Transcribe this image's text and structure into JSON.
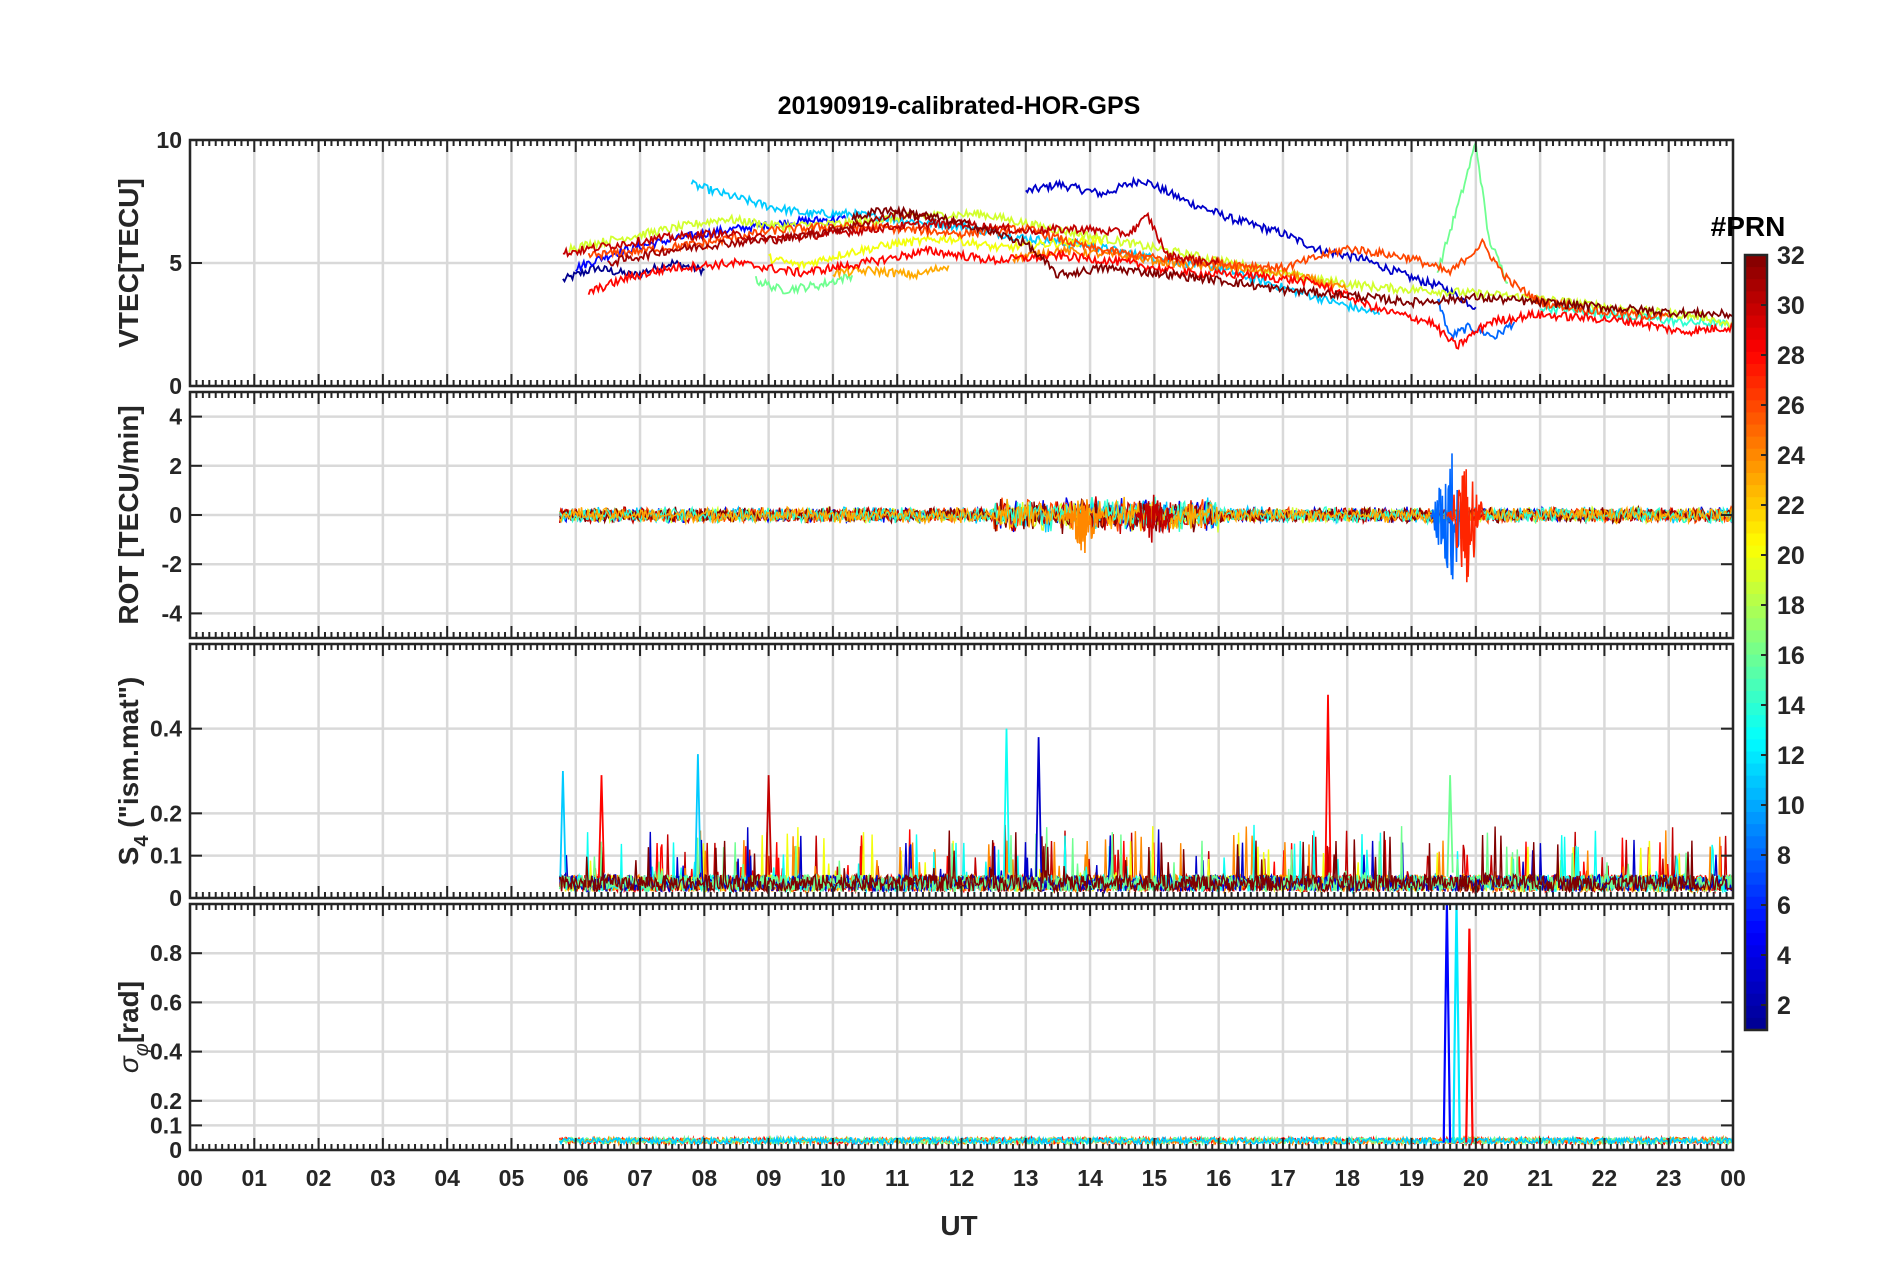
{
  "chart_data": {
    "type": "line",
    "title": "20190919-calibrated-HOR-GPS",
    "xlabel": "UT",
    "x_tick_labels": [
      "00",
      "01",
      "02",
      "03",
      "04",
      "05",
      "06",
      "07",
      "08",
      "09",
      "10",
      "11",
      "12",
      "13",
      "14",
      "15",
      "16",
      "17",
      "18",
      "19",
      "20",
      "21",
      "22",
      "23",
      "00"
    ],
    "xlim": [
      0,
      24
    ],
    "data_start_hour": 5.75,
    "grid": true,
    "panels": [
      {
        "id": "vtec",
        "ylabel": "VTEC[TECU]",
        "ylim": [
          0,
          10
        ],
        "yticks": [
          0,
          5,
          10
        ],
        "ytick_labels": [
          "0",
          "5",
          "10"
        ]
      },
      {
        "id": "rot",
        "ylabel": "ROT [TECU/min]",
        "ylim": [
          -5,
          5
        ],
        "yticks": [
          -4,
          -2,
          0,
          2,
          4
        ],
        "ytick_labels": [
          "-4",
          "-2",
          "0",
          "2",
          "4"
        ]
      },
      {
        "id": "s4",
        "ylabel_main": "S",
        "ylabel_sub": "4",
        "ylabel_rest": " (\"ism.mat\")",
        "ylim": [
          0,
          0.6
        ],
        "yticks": [
          0,
          0.1,
          0.2,
          0.4
        ],
        "ytick_labels": [
          "0",
          "0.1",
          "0.2",
          "0.4"
        ]
      },
      {
        "id": "sigma",
        "ylabel_main": "σ",
        "ylabel_sub": "φ",
        "ylabel_rest": "[rad]",
        "ylim": [
          0,
          1
        ],
        "yticks": [
          0,
          0.1,
          0.2,
          0.4,
          0.6,
          0.8
        ],
        "ytick_labels": [
          "0",
          "0.1",
          "0.2",
          "0.4",
          "0.6",
          "0.8"
        ]
      }
    ],
    "colorbar": {
      "title": "#PRN",
      "range": [
        1,
        32
      ],
      "ticks": [
        2,
        4,
        6,
        8,
        10,
        12,
        14,
        16,
        18,
        20,
        22,
        24,
        26,
        28,
        30,
        32
      ],
      "tick_labels": [
        "2",
        "4",
        "6",
        "8",
        "10",
        "12",
        "14",
        "16",
        "18",
        "20",
        "22",
        "24",
        "26",
        "28",
        "30",
        "32"
      ],
      "colormap": "jet",
      "colors": [
        "#00008f",
        "#0000ff",
        "#0080ff",
        "#00ffff",
        "#80ff80",
        "#ffff00",
        "#ff8000",
        "#ff0000",
        "#800000"
      ]
    },
    "approx_series": [
      {
        "prn": 1,
        "points": [
          [
            5.8,
            4.3
          ],
          [
            6.3,
            4.8
          ],
          [
            6.9,
            4.5
          ],
          [
            7.5,
            5.0
          ],
          [
            8.0,
            4.7
          ]
        ]
      },
      {
        "prn": 3,
        "points": [
          [
            13.0,
            7.9
          ],
          [
            13.5,
            8.2
          ],
          [
            14.2,
            7.8
          ],
          [
            14.8,
            8.4
          ],
          [
            15.5,
            7.5
          ],
          [
            16.2,
            6.8
          ],
          [
            17.0,
            6.2
          ],
          [
            17.6,
            5.5
          ],
          [
            18.2,
            5.2
          ],
          [
            19.0,
            4.4
          ],
          [
            19.5,
            4.0
          ],
          [
            20.0,
            3.2
          ]
        ]
      },
      {
        "prn": 5,
        "points": [
          [
            6.0,
            4.8
          ],
          [
            6.6,
            5.4
          ],
          [
            7.2,
            5.8
          ],
          [
            8.0,
            6.2
          ],
          [
            8.8,
            6.5
          ],
          [
            9.5,
            6.7
          ],
          [
            10.2,
            6.8
          ]
        ]
      },
      {
        "prn": 8,
        "points": [
          [
            19.4,
            3.6
          ],
          [
            19.6,
            2.0
          ],
          [
            19.9,
            2.4
          ],
          [
            20.3,
            2.0
          ],
          [
            20.6,
            2.6
          ]
        ]
      },
      {
        "prn": 11,
        "points": [
          [
            7.8,
            8.2
          ],
          [
            8.3,
            7.8
          ],
          [
            9.0,
            7.3
          ],
          [
            9.6,
            7.0
          ],
          [
            10.3,
            7.0
          ],
          [
            11.2,
            6.7
          ],
          [
            12.0,
            6.5
          ],
          [
            13.0,
            6.0
          ],
          [
            14.0,
            5.7
          ],
          [
            15.0,
            5.2
          ],
          [
            16.0,
            4.8
          ],
          [
            17.0,
            4.0
          ],
          [
            17.8,
            3.4
          ],
          [
            18.5,
            2.9
          ]
        ]
      },
      {
        "prn": 14,
        "points": [
          [
            21.0,
            3.2
          ],
          [
            21.8,
            3.0
          ],
          [
            22.5,
            2.8
          ],
          [
            23.2,
            2.6
          ],
          [
            24.0,
            2.5
          ]
        ]
      },
      {
        "prn": 16,
        "points": [
          [
            8.8,
            4.3
          ],
          [
            9.2,
            3.9
          ],
          [
            9.8,
            4.1
          ],
          [
            10.3,
            4.5
          ]
        ]
      },
      {
        "prn": 16,
        "points": [
          [
            19.4,
            4.6
          ],
          [
            19.8,
            8.0
          ],
          [
            20.0,
            9.9
          ],
          [
            20.2,
            6.0
          ],
          [
            20.5,
            4.2
          ]
        ]
      },
      {
        "prn": 19,
        "points": [
          [
            5.9,
            5.6
          ],
          [
            6.7,
            6.0
          ],
          [
            7.5,
            6.4
          ],
          [
            8.3,
            6.8
          ],
          [
            9.2,
            6.5
          ],
          [
            10.2,
            6.6
          ],
          [
            11.2,
            6.9
          ],
          [
            12.3,
            7.0
          ],
          [
            13.2,
            6.5
          ],
          [
            14.2,
            6.0
          ],
          [
            15.2,
            5.5
          ],
          [
            16.2,
            5.0
          ],
          [
            17.3,
            4.4
          ],
          [
            18.5,
            4.0
          ],
          [
            19.8,
            3.8
          ],
          [
            20.8,
            3.6
          ],
          [
            21.8,
            3.3
          ],
          [
            22.8,
            3.0
          ],
          [
            23.6,
            2.8
          ],
          [
            24.0,
            2.4
          ]
        ]
      },
      {
        "prn": 20,
        "points": [
          [
            9.0,
            5.2
          ],
          [
            9.5,
            4.9
          ],
          [
            10.2,
            5.4
          ],
          [
            11.0,
            5.8
          ],
          [
            11.8,
            6.0
          ],
          [
            12.6,
            5.6
          ],
          [
            13.4,
            5.8
          ],
          [
            14.2,
            5.9
          ]
        ]
      },
      {
        "prn": 23,
        "points": [
          [
            10.0,
            4.6
          ],
          [
            10.6,
            4.7
          ],
          [
            11.3,
            4.5
          ],
          [
            11.8,
            4.9
          ]
        ]
      },
      {
        "prn": 24,
        "points": [
          [
            12.8,
            5.2
          ],
          [
            13.5,
            5.5
          ],
          [
            14.5,
            5.3
          ],
          [
            15.5,
            4.9
          ],
          [
            16.3,
            4.8
          ],
          [
            17.2,
            4.5
          ],
          [
            18.0,
            3.9
          ]
        ]
      },
      {
        "prn": 26,
        "points": [
          [
            6.2,
            5.3
          ],
          [
            7.0,
            5.5
          ],
          [
            8.0,
            5.8
          ],
          [
            9.0,
            6.3
          ],
          [
            10.0,
            6.5
          ],
          [
            11.0,
            6.4
          ],
          [
            12.0,
            6.2
          ],
          [
            13.0,
            6.4
          ],
          [
            14.0,
            5.6
          ],
          [
            15.0,
            5.2
          ],
          [
            16.0,
            5.0
          ],
          [
            17.0,
            4.8
          ],
          [
            18.0,
            5.6
          ],
          [
            19.0,
            5.2
          ],
          [
            19.6,
            4.6
          ],
          [
            20.1,
            5.8
          ],
          [
            20.5,
            4.3
          ],
          [
            21.0,
            3.4
          ],
          [
            22.0,
            3.0
          ],
          [
            23.0,
            2.8
          ]
        ]
      },
      {
        "prn": 28,
        "points": [
          [
            6.2,
            3.8
          ],
          [
            6.8,
            4.4
          ],
          [
            7.5,
            4.8
          ],
          [
            8.5,
            5.0
          ],
          [
            9.5,
            4.6
          ],
          [
            10.5,
            5.0
          ],
          [
            11.5,
            5.5
          ],
          [
            12.5,
            5.1
          ],
          [
            13.5,
            5.3
          ],
          [
            14.6,
            5.0
          ],
          [
            15.4,
            4.6
          ],
          [
            16.5,
            4.5
          ],
          [
            17.5,
            4.2
          ],
          [
            18.5,
            3.1
          ],
          [
            19.3,
            2.6
          ],
          [
            19.7,
            1.6
          ],
          [
            20.2,
            2.6
          ],
          [
            20.9,
            2.9
          ],
          [
            21.6,
            2.8
          ],
          [
            22.5,
            2.6
          ],
          [
            23.2,
            2.2
          ],
          [
            24.0,
            2.4
          ]
        ]
      },
      {
        "prn": 30,
        "points": [
          [
            5.8,
            5.4
          ],
          [
            6.5,
            5.7
          ],
          [
            7.3,
            6.0
          ],
          [
            8.2,
            6.2
          ],
          [
            9.0,
            6.0
          ],
          [
            10.0,
            6.2
          ],
          [
            11.0,
            6.5
          ],
          [
            12.0,
            6.6
          ],
          [
            13.0,
            6.3
          ],
          [
            13.8,
            6.4
          ],
          [
            14.6,
            6.2
          ],
          [
            14.9,
            6.9
          ],
          [
            15.2,
            5.3
          ],
          [
            16.0,
            5.0
          ]
        ]
      },
      {
        "prn": 31,
        "points": [
          [
            6.5,
            5.0
          ],
          [
            7.4,
            5.5
          ],
          [
            8.3,
            5.8
          ],
          [
            9.3,
            6.0
          ],
          [
            10.3,
            6.5
          ],
          [
            11.0,
            7.0
          ],
          [
            11.6,
            6.8
          ]
        ]
      },
      {
        "prn": 32,
        "points": [
          [
            10.3,
            6.8
          ],
          [
            10.8,
            7.2
          ],
          [
            11.5,
            6.9
          ],
          [
            12.2,
            6.5
          ],
          [
            13.0,
            5.8
          ],
          [
            13.5,
            4.5
          ],
          [
            14.2,
            4.8
          ],
          [
            15.0,
            4.6
          ],
          [
            16.0,
            4.3
          ],
          [
            17.0,
            3.9
          ],
          [
            18.0,
            3.7
          ],
          [
            19.0,
            3.4
          ],
          [
            20.0,
            3.6
          ],
          [
            21.0,
            3.4
          ],
          [
            22.0,
            3.2
          ],
          [
            23.0,
            3.0
          ],
          [
            24.0,
            2.9
          ]
        ]
      }
    ],
    "rot_notes": "ROT values stay within about ±0.5 TECU/min except a burst near 19.5–20 UT reaching about +3 / -3.3.",
    "rot_bursts": [
      {
        "x": 19.6,
        "ymin": -3.3,
        "ymax": 3.0,
        "prn": 8
      },
      {
        "x": 19.85,
        "ymin": -3.0,
        "ymax": 2.4,
        "prn": 27
      },
      {
        "x": 13.9,
        "ymin": -1.7,
        "ymax": 0.8,
        "prn": 24
      },
      {
        "x": 15.0,
        "ymin": -1.4,
        "ymax": 0.9,
        "prn": 30
      }
    ],
    "s4_spikes": [
      {
        "x": 5.8,
        "y": 0.3,
        "prn": 11
      },
      {
        "x": 6.4,
        "y": 0.29,
        "prn": 28
      },
      {
        "x": 7.9,
        "y": 0.34,
        "prn": 11
      },
      {
        "x": 9.0,
        "y": 0.29,
        "prn": 30
      },
      {
        "x": 12.7,
        "y": 0.4,
        "prn": 13
      },
      {
        "x": 13.2,
        "y": 0.38,
        "prn": 3
      },
      {
        "x": 17.7,
        "y": 0.48,
        "prn": 28
      },
      {
        "x": 19.6,
        "y": 0.29,
        "prn": 16
      }
    ],
    "sigma_spikes": [
      {
        "x": 19.55,
        "y": 1.0,
        "prn": 5
      },
      {
        "x": 19.7,
        "y": 1.0,
        "prn": 12
      },
      {
        "x": 19.9,
        "y": 0.9,
        "prn": 28
      }
    ]
  }
}
